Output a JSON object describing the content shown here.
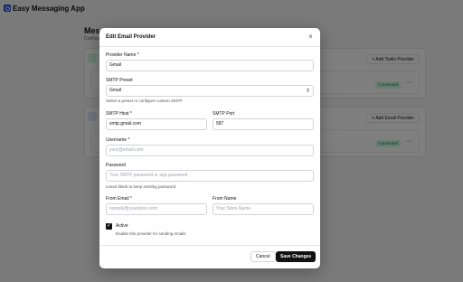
{
  "app": {
    "title": "Easy Messaging App"
  },
  "background": {
    "page_title": "Mess",
    "page_subtitle": "Configu",
    "twilio_add_button": "+ Add Twilio Provider",
    "email_add_button": "+ Add Email Provider",
    "twilio_status": "Connected",
    "email_status": "Connected",
    "more_menu": "···"
  },
  "modal": {
    "title": "Edit Email Provider",
    "close_icon": "×",
    "provider_name": {
      "label": "Provider Name *",
      "value": "Gmail"
    },
    "smtp_preset": {
      "label": "SMTP Preset",
      "value": "Gmail",
      "hint": "Select a preset or configure custom SMTP"
    },
    "smtp_host": {
      "label": "SMTP Host *",
      "value": "smtp.gmail.com"
    },
    "smtp_port": {
      "label": "SMTP Port",
      "value": "587"
    },
    "username": {
      "label": "Username *",
      "placeholder": "your@email.com"
    },
    "password": {
      "label": "Password",
      "placeholder": "Your SMTP password or app password",
      "hint": "Leave blank to keep existing password"
    },
    "from_email": {
      "label": "From Email *",
      "placeholder": "noreply@yourstore.com"
    },
    "from_name": {
      "label": "From Name",
      "placeholder": "Your Store Name"
    },
    "active": {
      "label": "Active",
      "checked": true,
      "hint": "Enable this provider for sending emails"
    },
    "cancel_button": "Cancel",
    "save_button": "Save Changes"
  },
  "icons": {
    "checkmark": "✓",
    "chevron": "chevron-up-down-icon"
  }
}
